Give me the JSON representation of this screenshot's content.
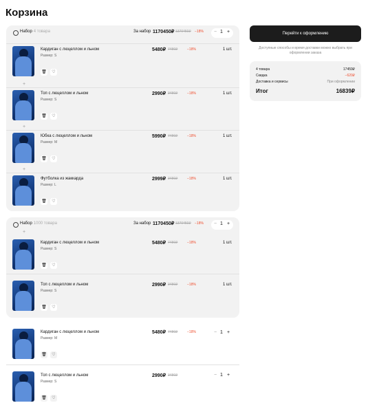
{
  "page": {
    "title": "Корзина"
  },
  "sets": [
    {
      "name": "Набор",
      "count": "4 товара",
      "price_label": "За набор",
      "price": "1170450₽",
      "old_price": "1370450₽",
      "discount": "−18%",
      "qty": "1",
      "items": [
        {
          "name": "Кардиган с люцеллом и льном",
          "size": "Размер: S",
          "price": "5480₽",
          "old_price": "7480₽",
          "discount": "−18%",
          "qty": "1 шт."
        },
        {
          "name": "Топ с люцеллом и льном",
          "size": "Размер: S",
          "price": "2990₽",
          "old_price": "3480₽",
          "discount": "−18%",
          "qty": "1 шт."
        },
        {
          "name": "Юбка с люцеллом и льном",
          "size": "Размер: M",
          "price": "5990₽",
          "old_price": "7480₽",
          "discount": "−18%",
          "qty": "1 шт."
        },
        {
          "name": "Футболка из жаккарда",
          "size": "Размер: L",
          "price": "2999₽",
          "old_price": "3480₽",
          "discount": "−18%",
          "qty": "1 шт."
        }
      ]
    },
    {
      "name": "Набор",
      "count": "1000 товара",
      "price_label": "За набор",
      "price": "1170450₽",
      "old_price": "1370450₽",
      "discount": "−18%",
      "qty": "1",
      "items": [
        {
          "name": "Кардиган с люцеллом и льном",
          "size": "Размер: S",
          "price": "5480₽",
          "old_price": "7480₽",
          "discount": "−18%",
          "qty": "1 шт."
        },
        {
          "name": "Топ с люцеллом и льном",
          "size": "Размер: S",
          "price": "2990₽",
          "old_price": "3480₽",
          "discount": "−18%",
          "qty": "1 шт."
        }
      ]
    }
  ],
  "items": [
    {
      "name": "Кардиган с люцеллом и льном",
      "size": "Размер: M",
      "price": "5480₽",
      "old_price": "7480₽",
      "discount": "−18%",
      "qty": "1"
    },
    {
      "name": "Топ с люцеллом и льном",
      "size": "Размер: S",
      "price": "2990₽",
      "old_price": "3480₽",
      "discount": "",
      "qty": "1"
    }
  ],
  "checkout": {
    "button": "Перейти к оформлению",
    "note": "Доступные способы и время доставки можно выбрать при оформлении заказа"
  },
  "summary": {
    "rows": [
      {
        "label": "4 товара",
        "value": "17459₽"
      },
      {
        "label": "Скидка",
        "value": "−620₽"
      },
      {
        "label": "Доставка и сервисы",
        "value": "При оформлении"
      }
    ],
    "total_label": "Итог",
    "total_value": "16839₽"
  },
  "colors": {
    "accent": "#ef4c2c",
    "dark": "#1c1c1c",
    "panel": "#f2f2f2"
  },
  "icons": {
    "set": "set-icon",
    "delete": "trash-icon",
    "favorite": "heart-icon"
  }
}
